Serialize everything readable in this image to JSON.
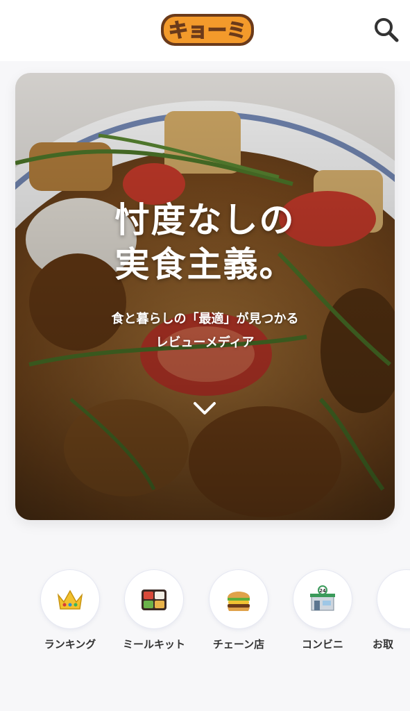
{
  "header": {
    "logo_text": "キョーミ",
    "search_icon": "search-icon"
  },
  "hero": {
    "title_line1": "忖度なしの",
    "title_line2": "実食主義。",
    "subtitle_line1": "食と暮らしの「最適」が見つかる",
    "subtitle_line2": "レビューメディア",
    "scroll_icon": "chevron-down-icon"
  },
  "categories": [
    {
      "label": "ランキング",
      "icon": "crown-icon"
    },
    {
      "label": "ミールキット",
      "icon": "bento-icon"
    },
    {
      "label": "チェーン店",
      "icon": "burger-icon"
    },
    {
      "label": "コンビニ",
      "icon": "convenience-store-icon"
    },
    {
      "label": "お取",
      "icon": "partial-icon"
    }
  ],
  "colors": {
    "logo_orange": "#f39a2b",
    "logo_outline": "#6b3a1a",
    "text_dark": "#333333",
    "page_bg": "#f7f7f9"
  }
}
